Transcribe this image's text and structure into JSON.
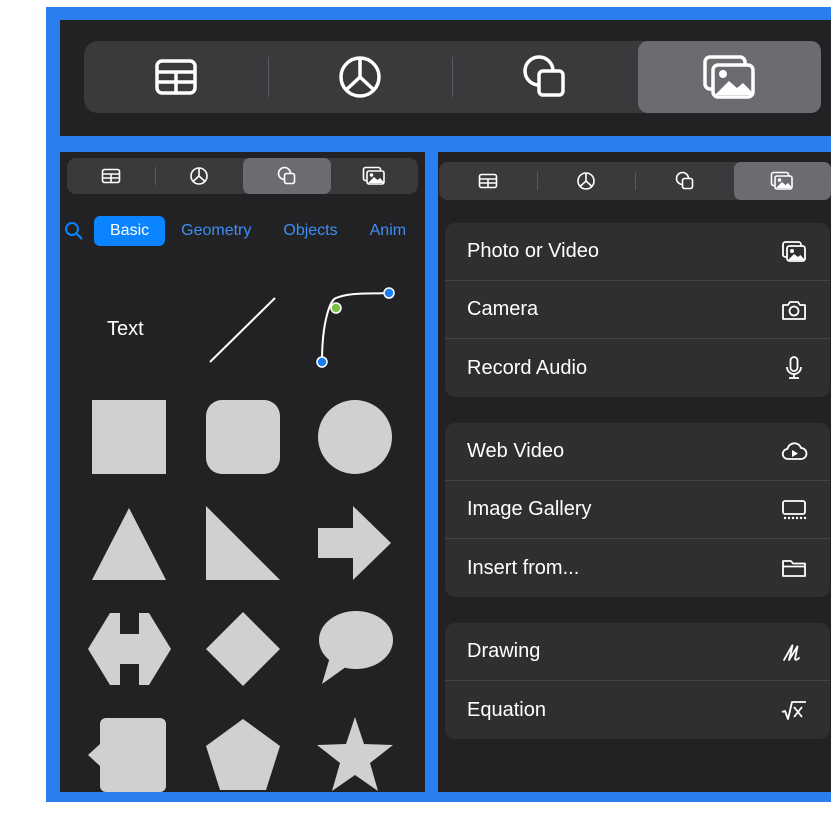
{
  "top_toolbar": {
    "tabs": [
      {
        "name": "table-icon"
      },
      {
        "name": "chart-icon"
      },
      {
        "name": "shape-icon"
      },
      {
        "name": "media-icon",
        "selected": true
      }
    ]
  },
  "shapes_panel": {
    "tabs": [
      {
        "name": "table-icon"
      },
      {
        "name": "chart-icon"
      },
      {
        "name": "shape-icon",
        "selected": true
      },
      {
        "name": "media-icon"
      }
    ],
    "categories": [
      "Basic",
      "Geometry",
      "Objects",
      "Anim"
    ],
    "active_category": "Basic",
    "text_shape_label": "Text",
    "shapes": [
      "text",
      "line",
      "curve",
      "square",
      "rounded-square",
      "circle",
      "triangle",
      "right-triangle",
      "arrow",
      "double-arrow",
      "diamond",
      "speech-bubble",
      "callout",
      "pentagon",
      "star"
    ]
  },
  "media_panel": {
    "tabs": [
      {
        "name": "table-icon"
      },
      {
        "name": "chart-icon"
      },
      {
        "name": "shape-icon"
      },
      {
        "name": "media-icon",
        "selected": true
      }
    ],
    "groups": [
      {
        "items": [
          {
            "label": "Photo or Video",
            "icon": "photo-icon"
          },
          {
            "label": "Camera",
            "icon": "camera-icon"
          },
          {
            "label": "Record Audio",
            "icon": "microphone-icon"
          }
        ]
      },
      {
        "items": [
          {
            "label": "Web Video",
            "icon": "cloud-play-icon"
          },
          {
            "label": "Image Gallery",
            "icon": "gallery-icon"
          },
          {
            "label": "Insert from...",
            "icon": "folder-icon"
          }
        ]
      },
      {
        "items": [
          {
            "label": "Drawing",
            "icon": "drawing-icon"
          },
          {
            "label": "Equation",
            "icon": "equation-icon"
          }
        ]
      }
    ]
  },
  "colors": {
    "highlight": "#2a7ef0",
    "panel_bg": "#222224",
    "accent": "#0a84ff",
    "shape_fill": "#d0d0d2"
  }
}
